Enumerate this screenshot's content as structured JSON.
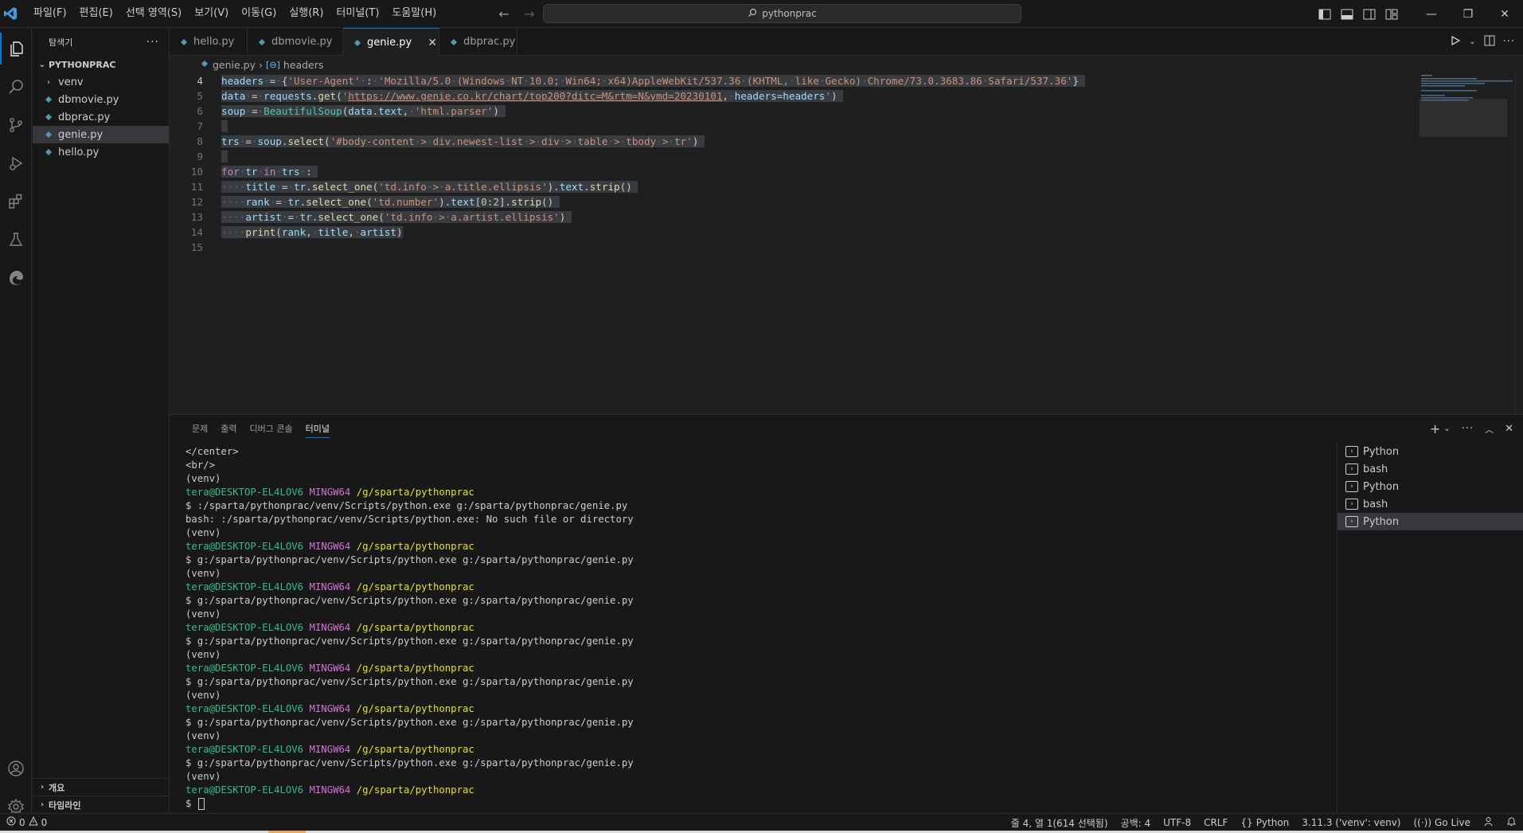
{
  "titlebar": {
    "menu": [
      "파일(F)",
      "편집(E)",
      "선택 영역(S)",
      "보기(V)",
      "이동(G)",
      "실행(R)",
      "터미널(T)",
      "도움말(H)"
    ],
    "search_text": "pythonprac"
  },
  "activity": {
    "icons": [
      "explorer-icon",
      "search-icon",
      "source-control-icon",
      "run-debug-icon",
      "extensions-icon",
      "testing-icon",
      "edge-devtools-icon",
      "account-icon",
      "settings-gear-icon"
    ]
  },
  "sidebar": {
    "title": "탐색기",
    "root": "PYTHONPRAC",
    "items": [
      {
        "label": "venv",
        "kind": "folder"
      },
      {
        "label": "dbmovie.py",
        "kind": "file"
      },
      {
        "label": "dbprac.py",
        "kind": "file"
      },
      {
        "label": "genie.py",
        "kind": "file",
        "selected": true
      },
      {
        "label": "hello.py",
        "kind": "file"
      }
    ],
    "bottom_sections": [
      "개요",
      "타임라인"
    ]
  },
  "editor": {
    "tabs": [
      {
        "label": "hello.py",
        "active": false
      },
      {
        "label": "dbmovie.py",
        "active": false
      },
      {
        "label": "genie.py",
        "active": true
      },
      {
        "label": "dbprac.py",
        "active": false
      }
    ],
    "breadcrumb": {
      "file": "genie.py",
      "symbol": "headers"
    },
    "line_numbers": [
      "4",
      "5",
      "6",
      "7",
      "8",
      "9",
      "10",
      "11",
      "12",
      "13",
      "14",
      "15"
    ]
  },
  "panel": {
    "tabs": [
      "문제",
      "출력",
      "디버그 콘솔",
      "터미널"
    ],
    "active_tab": "터미널",
    "terminal_lines": [
      {
        "type": "plain",
        "text": "</center>"
      },
      {
        "type": "plain",
        "text": "<br/>"
      },
      {
        "type": "plain",
        "text": "(venv)"
      },
      {
        "type": "prompt",
        "user": "tera@DESKTOP-EL4LOV6",
        "host": "MINGW64",
        "path": "/g/sparta/pythonprac"
      },
      {
        "type": "plain",
        "text": "$ :/sparta/pythonprac/venv/Scripts/python.exe g:/sparta/pythonprac/genie.py"
      },
      {
        "type": "plain",
        "text": "bash: :/sparta/pythonprac/venv/Scripts/python.exe: No such file or directory"
      },
      {
        "type": "plain",
        "text": "(venv)"
      },
      {
        "type": "prompt",
        "user": "tera@DESKTOP-EL4LOV6",
        "host": "MINGW64",
        "path": "/g/sparta/pythonprac"
      },
      {
        "type": "plain",
        "text": "$ g:/sparta/pythonprac/venv/Scripts/python.exe g:/sparta/pythonprac/genie.py"
      },
      {
        "type": "plain",
        "text": "(venv)"
      },
      {
        "type": "prompt",
        "user": "tera@DESKTOP-EL4LOV6",
        "host": "MINGW64",
        "path": "/g/sparta/pythonprac"
      },
      {
        "type": "plain",
        "text": "$ g:/sparta/pythonprac/venv/Scripts/python.exe g:/sparta/pythonprac/genie.py"
      },
      {
        "type": "plain",
        "text": "(venv)"
      },
      {
        "type": "prompt",
        "user": "tera@DESKTOP-EL4LOV6",
        "host": "MINGW64",
        "path": "/g/sparta/pythonprac"
      },
      {
        "type": "plain",
        "text": "$ g:/sparta/pythonprac/venv/Scripts/python.exe g:/sparta/pythonprac/genie.py"
      },
      {
        "type": "plain",
        "text": "(venv)"
      },
      {
        "type": "prompt",
        "user": "tera@DESKTOP-EL4LOV6",
        "host": "MINGW64",
        "path": "/g/sparta/pythonprac"
      },
      {
        "type": "plain",
        "text": "$ g:/sparta/pythonprac/venv/Scripts/python.exe g:/sparta/pythonprac/genie.py"
      },
      {
        "type": "plain",
        "text": "(venv)"
      },
      {
        "type": "prompt",
        "user": "tera@DESKTOP-EL4LOV6",
        "host": "MINGW64",
        "path": "/g/sparta/pythonprac"
      },
      {
        "type": "plain",
        "text": "$ g:/sparta/pythonprac/venv/Scripts/python.exe g:/sparta/pythonprac/genie.py"
      },
      {
        "type": "plain",
        "text": "(venv)"
      },
      {
        "type": "prompt",
        "user": "tera@DESKTOP-EL4LOV6",
        "host": "MINGW64",
        "path": "/g/sparta/pythonprac"
      },
      {
        "type": "plain",
        "text": "$ g:/sparta/pythonprac/venv/Scripts/python.exe g:/sparta/pythonprac/genie.py"
      },
      {
        "type": "plain",
        "text": "(venv)"
      },
      {
        "type": "prompt",
        "user": "tera@DESKTOP-EL4LOV6",
        "host": "MINGW64",
        "path": "/g/sparta/pythonprac"
      },
      {
        "type": "input",
        "text": "$ "
      }
    ],
    "terminals": [
      {
        "label": "Python",
        "active": false
      },
      {
        "label": "bash",
        "active": false
      },
      {
        "label": "Python",
        "active": false
      },
      {
        "label": "bash",
        "active": false
      },
      {
        "label": "Python",
        "active": true
      }
    ]
  },
  "statusbar": {
    "errors": "0",
    "warnings": "0",
    "position": "줄 4, 열 1(614 선택됨)",
    "indent": "공백: 4",
    "encoding": "UTF-8",
    "eol": "CRLF",
    "language": "Python",
    "interpreter": "3.11.3 ('venv': venv)",
    "golive": "Go Live"
  },
  "colors": {
    "accent": "#0078d4",
    "python_icon": "#519aba",
    "term_green": "#2fbe8a",
    "term_magenta": "#d670d6",
    "term_yellow": "#e5e510"
  }
}
